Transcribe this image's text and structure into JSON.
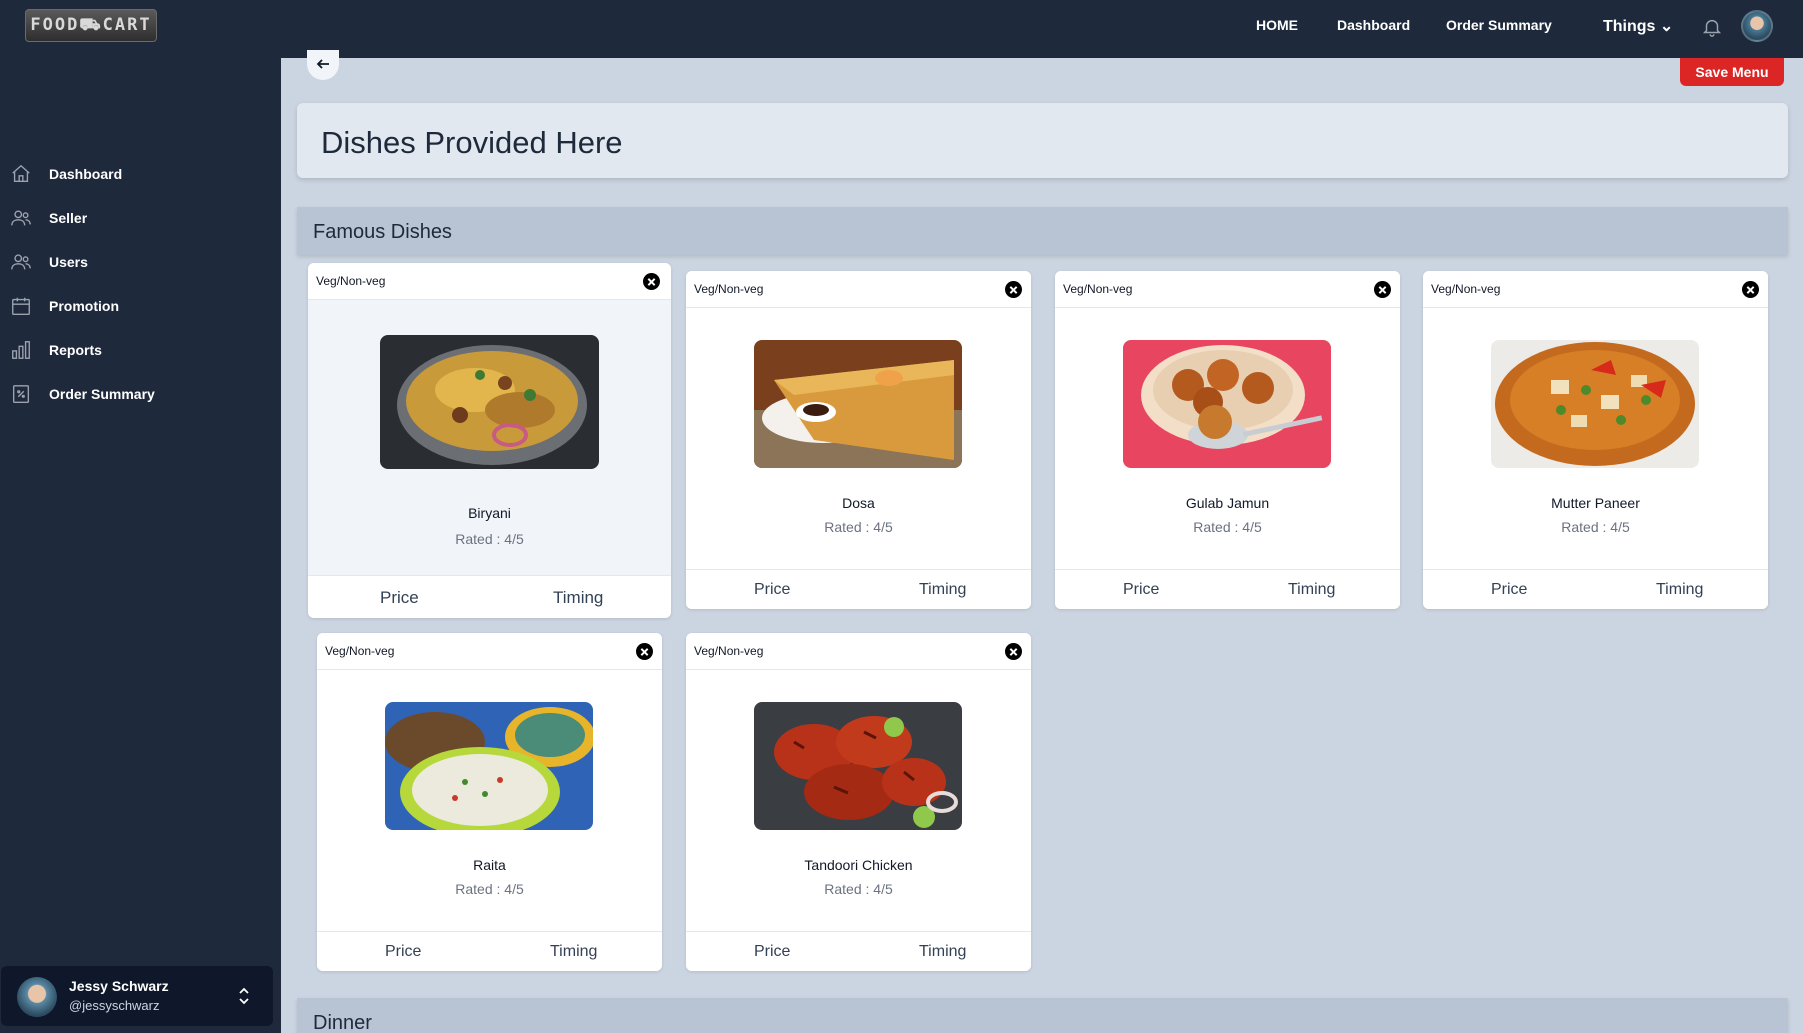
{
  "brand": {
    "logo_text": "FOOD⛟CART"
  },
  "topnav": {
    "home": "HOME",
    "dashboard": "Dashboard",
    "order_summary": "Order Summary",
    "things": "Things ⌄"
  },
  "sidebar": {
    "items": [
      {
        "label": "Dashboard",
        "icon": "home-icon"
      },
      {
        "label": "Seller",
        "icon": "users-icon"
      },
      {
        "label": "Users",
        "icon": "users-icon"
      },
      {
        "label": "Promotion",
        "icon": "calendar-icon"
      },
      {
        "label": "Reports",
        "icon": "bar-chart-icon"
      },
      {
        "label": "Order Summary",
        "icon": "receipt-icon"
      }
    ],
    "user": {
      "name": "Jessy Schwarz",
      "handle": "@jessyschwarz"
    }
  },
  "main": {
    "save_label": "Save Menu",
    "page_title": "Dishes Provided Here",
    "sections": {
      "famous": "Famous Dishes",
      "dinner": "Dinner"
    },
    "dishes": [
      {
        "type": "Veg/Non-veg",
        "name": "Biryani",
        "rating": "Rated : 4/5",
        "price": "Price",
        "timing": "Timing"
      },
      {
        "type": "Veg/Non-veg",
        "name": "Dosa",
        "rating": "Rated : 4/5",
        "price": "Price",
        "timing": "Timing"
      },
      {
        "type": "Veg/Non-veg",
        "name": "Gulab Jamun",
        "rating": "Rated : 4/5",
        "price": "Price",
        "timing": "Timing"
      },
      {
        "type": "Veg/Non-veg",
        "name": "Mutter Paneer",
        "rating": "Rated : 4/5",
        "price": "Price",
        "timing": "Timing"
      },
      {
        "type": "Veg/Non-veg",
        "name": "Raita",
        "rating": "Rated : 4/5",
        "price": "Price",
        "timing": "Timing"
      },
      {
        "type": "Veg/Non-veg",
        "name": "Tandoori Chicken",
        "rating": "Rated : 4/5",
        "price": "Price",
        "timing": "Timing"
      }
    ]
  },
  "colors": {
    "sidebar_bg": "#1e293b",
    "content_bg": "#cbd5e1",
    "save_button": "#dc2626"
  }
}
